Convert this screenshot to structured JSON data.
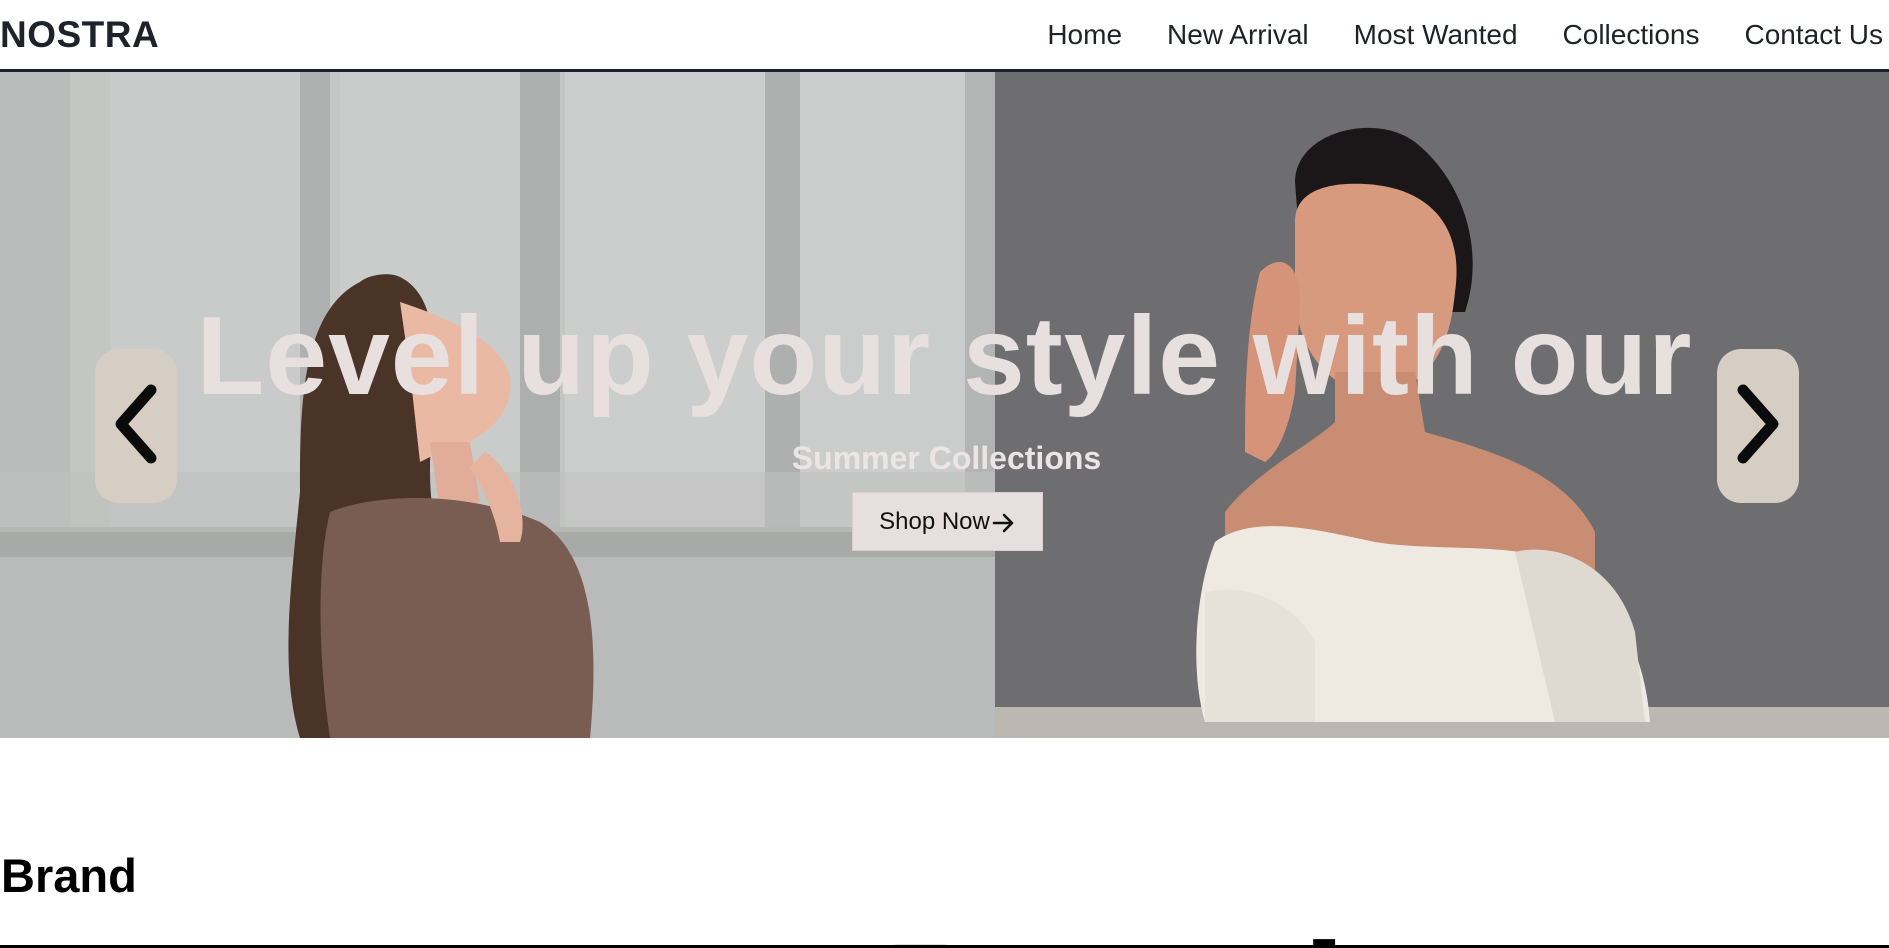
{
  "header": {
    "logo": "NOSTRA",
    "nav": [
      "Home",
      "New Arrival",
      "Most Wanted",
      "Collections",
      "Contact Us"
    ]
  },
  "hero": {
    "headline": "Level up your style with our",
    "subheadline": "Summer Collections",
    "cta_label": "Shop Now",
    "prev_icon": "chevron-left-icon",
    "next_icon": "chevron-right-icon"
  },
  "brand": {
    "title": "Brand",
    "peek_text": "Brand..."
  },
  "colors": {
    "text_dark": "#1f2329",
    "headline": "#e8dfdf",
    "slide_button": "#d6cec4",
    "cta_bg": "#e7dfdf"
  }
}
